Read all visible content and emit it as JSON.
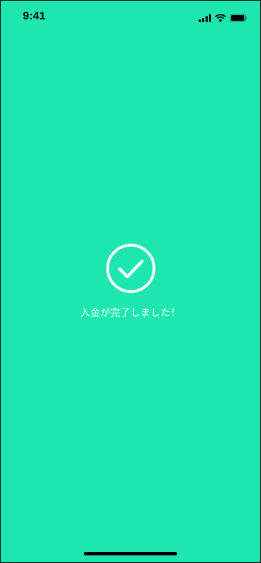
{
  "status_bar": {
    "time": "9:41",
    "icons": [
      "cellular-signal-icon",
      "wifi-icon",
      "battery-icon"
    ]
  },
  "colors": {
    "background": "#1de6b1",
    "foreground": "#ffffff",
    "status_text": "#000000"
  },
  "success": {
    "icon": "check-circle-icon",
    "message": "入金が完了しました！"
  }
}
